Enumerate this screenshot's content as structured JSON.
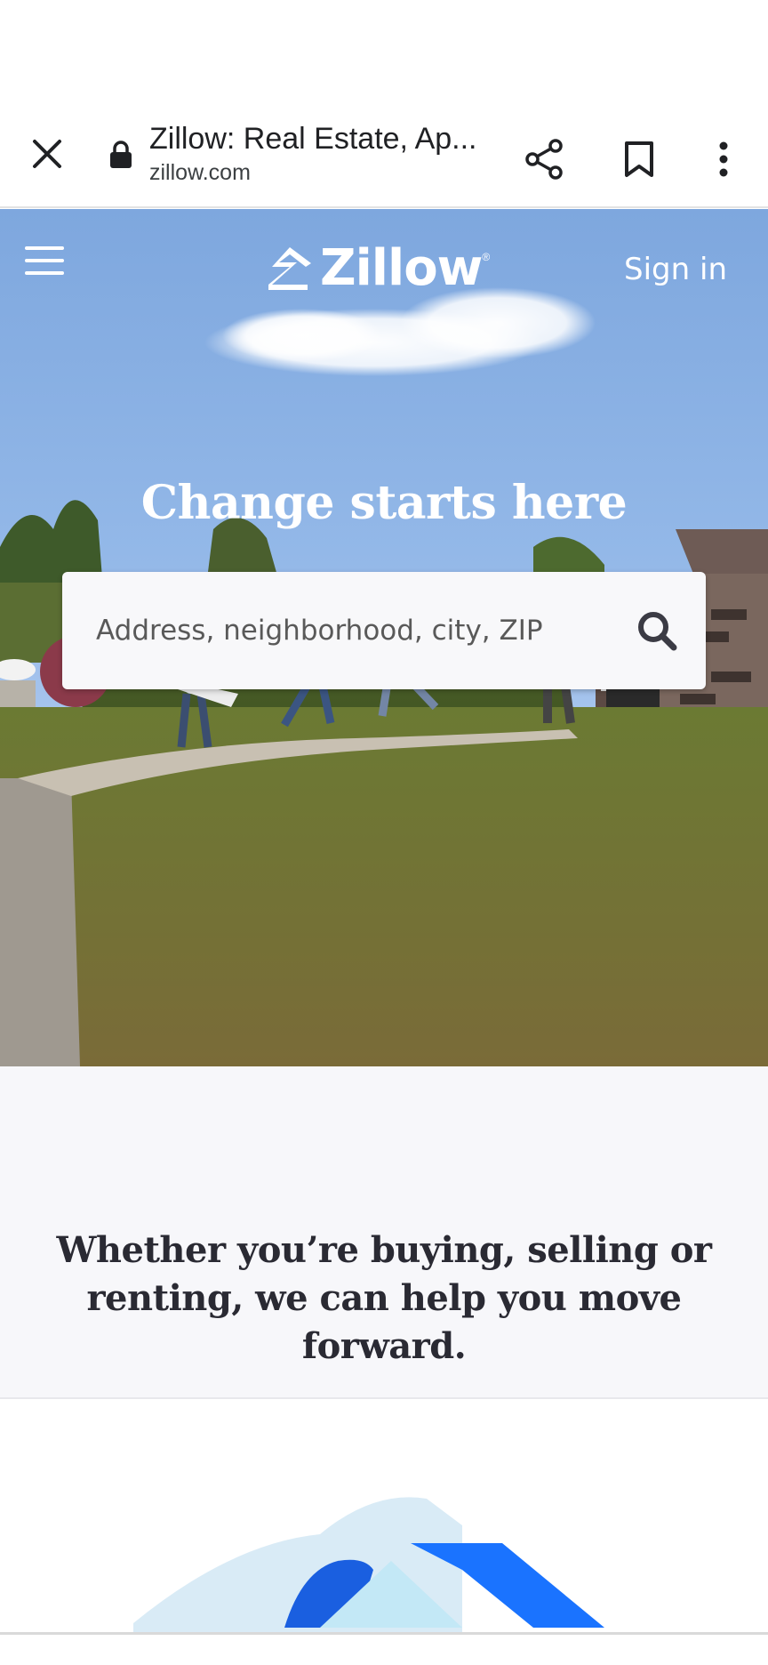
{
  "browser": {
    "page_title": "Zillow: Real Estate, Ap...",
    "domain": "zillow.com",
    "icons": [
      "close-icon",
      "lock-icon",
      "share-icon",
      "bookmark-icon",
      "more-vert-icon"
    ]
  },
  "header": {
    "logo_text": "Zillow",
    "signin_label": "Sign in",
    "icons": [
      "menu-icon",
      "zillow-logo-icon"
    ]
  },
  "hero": {
    "title": "Change starts here",
    "search": {
      "placeholder": "Address, neighborhood, city, ZIP",
      "value": ""
    }
  },
  "tagline": {
    "text": "Whether you’re buying, selling or renting, we can help you move forward."
  },
  "colors": {
    "brand_blue": "#006aff",
    "sky": "#8fb3e6",
    "text_dark": "#2a2a33",
    "search_icon": "#3b3b44"
  }
}
